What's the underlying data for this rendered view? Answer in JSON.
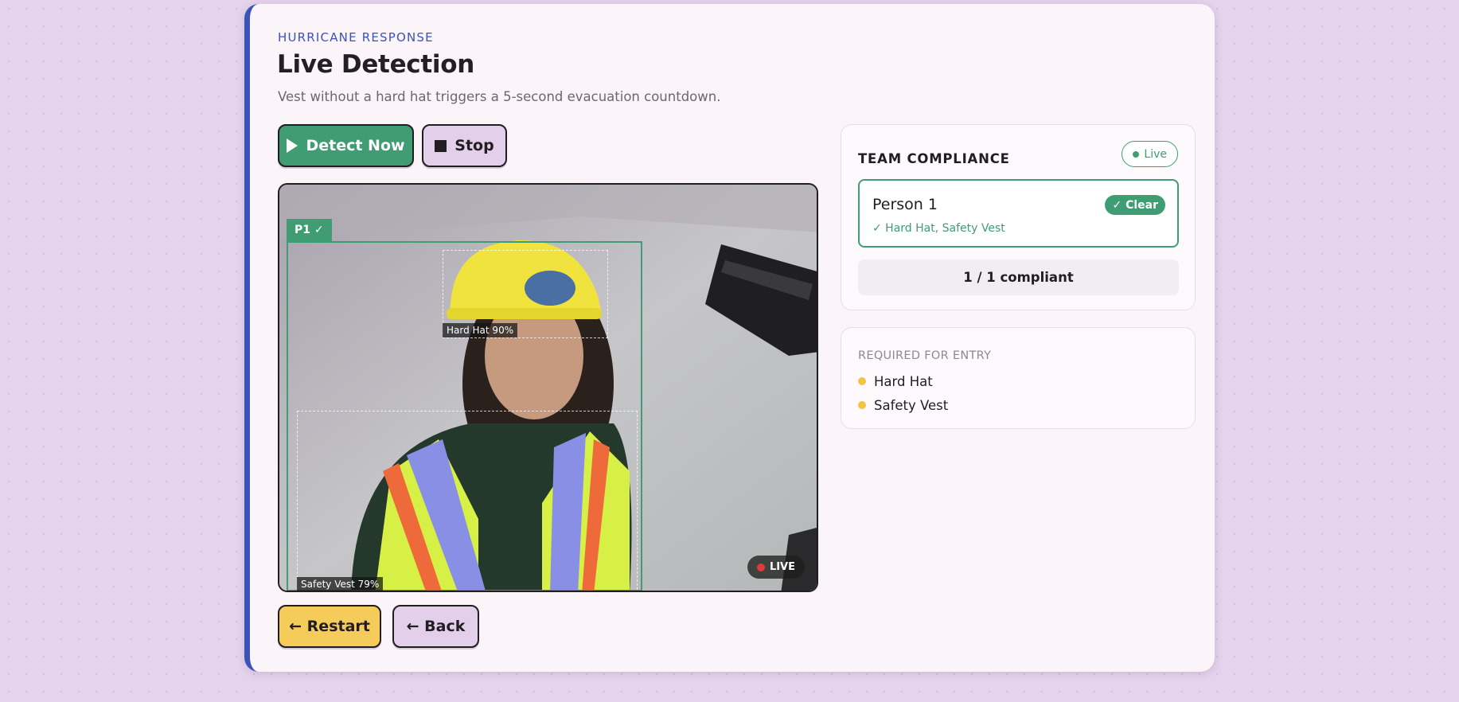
{
  "header": {
    "eyebrow": "HURRICANE RESPONSE",
    "title": "Live Detection",
    "subtitle": "Vest without a hard hat triggers a 5-second evacuation countdown."
  },
  "controls": {
    "detect_label": "Detect Now",
    "stop_label": "Stop",
    "restart_label": "← Restart",
    "back_label": "← Back"
  },
  "video": {
    "person_tag": "P1 ✓",
    "detections": [
      {
        "label": "Hard Hat 90%",
        "class": "Hard Hat",
        "confidence": 0.9
      },
      {
        "label": "Safety Vest 79%",
        "class": "Safety Vest",
        "confidence": 0.79
      }
    ],
    "live_badge": "LIVE"
  },
  "compliance": {
    "heading": "TEAM COMPLIANCE",
    "status_pill": "Live",
    "people": [
      {
        "name": "Person 1",
        "status": "✓ Clear",
        "items": "✓ Hard Hat, Safety Vest"
      }
    ],
    "summary": "1 / 1 compliant"
  },
  "required": {
    "heading": "REQUIRED FOR ENTRY",
    "items": [
      "Hard Hat",
      "Safety Vest"
    ]
  },
  "colors": {
    "accent": "#3b53b8",
    "success": "#3f9c73",
    "warning": "#f5cb59",
    "secondary": "#e3cfe9"
  }
}
